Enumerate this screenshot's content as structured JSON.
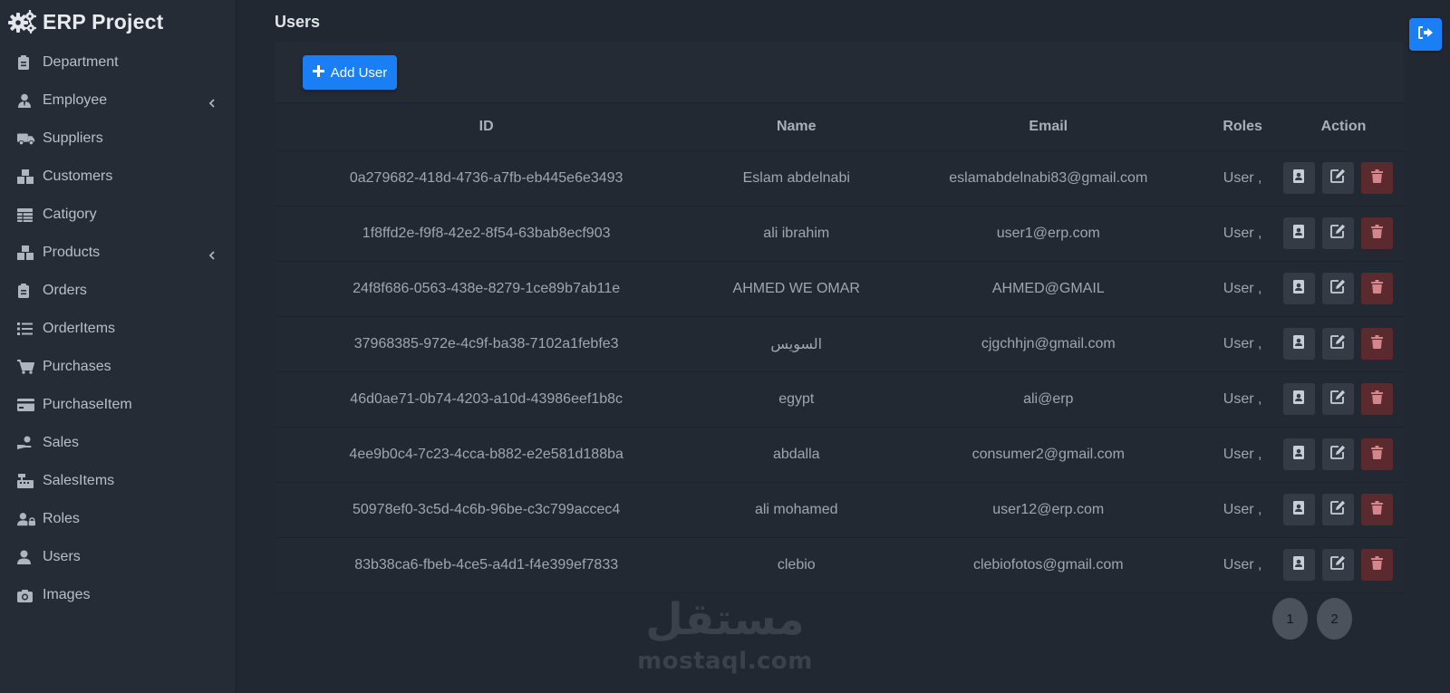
{
  "app": {
    "title": "ERP Project"
  },
  "sidebar": {
    "items": [
      {
        "label": "Department",
        "icon": "clipboard-icon"
      },
      {
        "label": "Employee",
        "icon": "user-tie-icon",
        "has_submenu": true
      },
      {
        "label": "Suppliers",
        "icon": "truck-icon"
      },
      {
        "label": "Customers",
        "icon": "boxes-icon"
      },
      {
        "label": "Catigory",
        "icon": "table-icon"
      },
      {
        "label": "Products",
        "icon": "boxes-icon",
        "has_submenu": true
      },
      {
        "label": "Orders",
        "icon": "clipboard-icon"
      },
      {
        "label": "OrderItems",
        "icon": "list-icon"
      },
      {
        "label": "Purchases",
        "icon": "cart-icon"
      },
      {
        "label": "PurchaseItem",
        "icon": "credit-card-icon"
      },
      {
        "label": "Sales",
        "icon": "hand-dollar-icon"
      },
      {
        "label": "SalesItems",
        "icon": "cash-register-icon"
      },
      {
        "label": "Roles",
        "icon": "user-lock-icon"
      },
      {
        "label": "Users",
        "icon": "user-icon"
      },
      {
        "label": "Images",
        "icon": "camera-icon"
      }
    ]
  },
  "page": {
    "title": "Users"
  },
  "toolbar": {
    "add_label": "Add User"
  },
  "table": {
    "headers": {
      "id": "ID",
      "name": "Name",
      "email": "Email",
      "roles": "Roles",
      "action": "Action"
    },
    "rows": [
      {
        "id": "0a279682-418d-4736-a7fb-eb445e6e3493",
        "name": "Eslam abdelnabi",
        "email": "eslamabdelnabi83@gmail.com",
        "roles": "User ,"
      },
      {
        "id": "1f8ffd2e-f9f8-42e2-8f54-63bab8ecf903",
        "name": "ali ibrahim",
        "email": "user1@erp.com",
        "roles": "User ,"
      },
      {
        "id": "24f8f686-0563-438e-8279-1ce89b7ab11e",
        "name": "AHMED WE OMAR",
        "email": "AHMED@GMAIL",
        "roles": "User ,"
      },
      {
        "id": "37968385-972e-4c9f-ba38-7102a1febfe3",
        "name": "السويس",
        "email": "cjgchhjn@gmail.com",
        "roles": "User ,"
      },
      {
        "id": "46d0ae71-0b74-4203-a10d-43986eef1b8c",
        "name": "egypt",
        "email": "ali@erp",
        "roles": "User ,"
      },
      {
        "id": "4ee9b0c4-7c23-4cca-b882-e2e581d188ba",
        "name": "abdalla",
        "email": "consumer2@gmail.com",
        "roles": "User ,"
      },
      {
        "id": "50978ef0-3c5d-4c6b-96be-c3c799accec4",
        "name": "ali mohamed",
        "email": "user12@erp.com",
        "roles": "User ,"
      },
      {
        "id": "83b38ca6-fbeb-4ce5-a4d1-f4e399ef7833",
        "name": "clebio",
        "email": "clebiofotos@gmail.com",
        "roles": "User ,"
      }
    ]
  },
  "pagination": {
    "pages": [
      "1",
      "2"
    ]
  },
  "watermark": {
    "arabic": "مستقل",
    "latin": "mostaql.com"
  },
  "colors": {
    "primary": "#1a7ff5",
    "danger": "#5b2a2f",
    "sidebar_bg": "#262c35",
    "page_bg": "#222831"
  }
}
